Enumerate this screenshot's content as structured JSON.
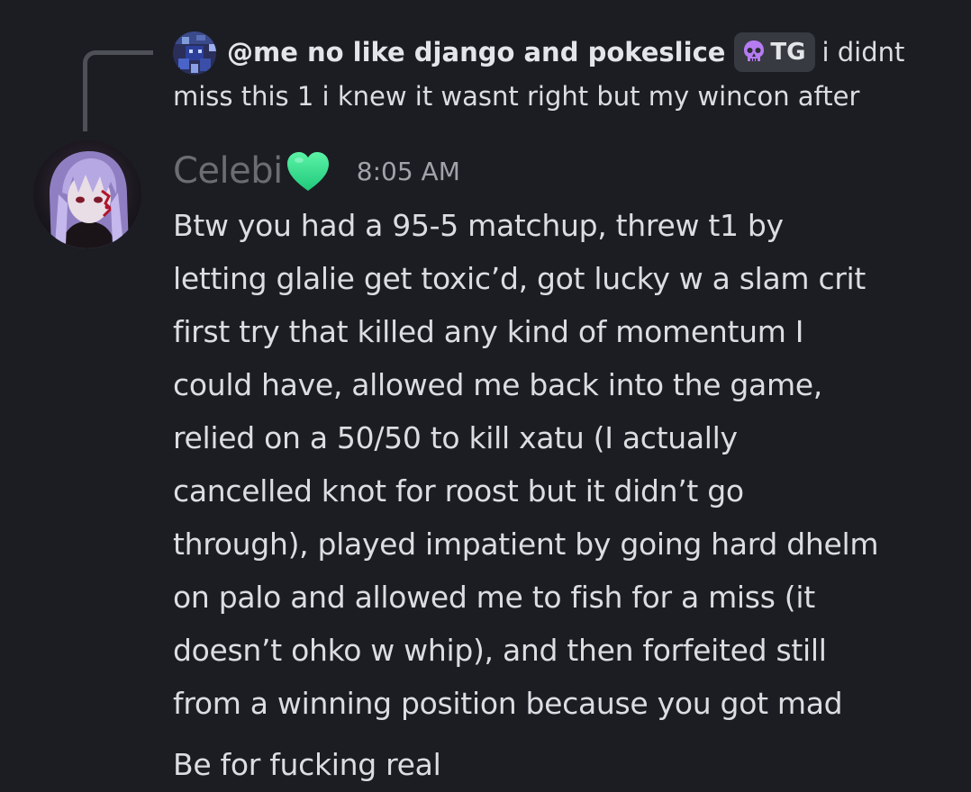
{
  "reply": {
    "author": "@me no like django and pokeslice",
    "tag": {
      "icon": "skull-icon",
      "label": "TG"
    },
    "text": "i didnt miss this 1 i knew it wasnt right but my wincon after",
    "avatar_icon": "pixel-art-avatar-icon"
  },
  "message": {
    "author": "Celebi",
    "author_emoji": "green-heart-icon",
    "timestamp": "8:05 AM",
    "avatar_icon": "anime-girl-avatar-icon",
    "lines": [
      "Btw you had a 95-5 matchup, threw t1 by",
      "letting glalie get toxic’d, got lucky w a slam crit",
      "first try that killed any kind of momentum I",
      "could have, allowed me back into the game,",
      "relied on a 50/50 to kill xatu (I actually",
      "cancelled knot for roost but it didn’t go",
      "through), played impatient by going hard dhelm",
      "on palo and allowed me to fish for a miss (it",
      "doesn’t ohko w whip), and then forfeited still",
      "from a winning position because you got mad"
    ]
  },
  "followup": {
    "text": "Be for fucking real"
  },
  "colors": {
    "background": "#1c1d23",
    "text": "#dbdee1",
    "username": "#6b6d73",
    "heart": "#3ee88f",
    "tag_background": "#383a42"
  }
}
